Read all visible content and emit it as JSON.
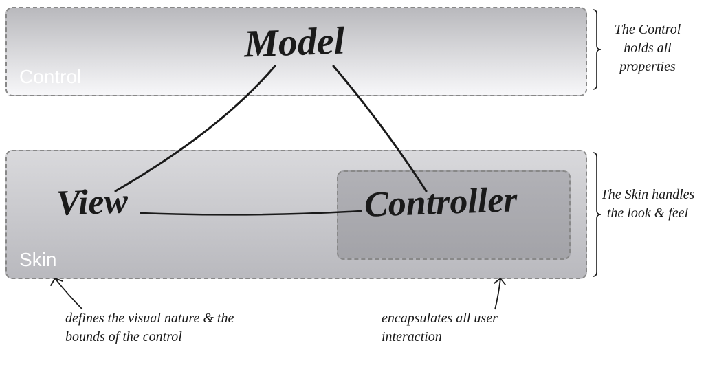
{
  "boxes": {
    "control_label": "Control",
    "skin_label": "Skin"
  },
  "nodes": {
    "model": "Model",
    "view": "View",
    "controller": "Controller"
  },
  "annotations": {
    "control_note": "The Control holds all properties",
    "skin_note": "The Skin handles the look & feel",
    "view_note": "defines the visual nature & the bounds of the control",
    "controller_note": "encapsulates all user interaction"
  }
}
